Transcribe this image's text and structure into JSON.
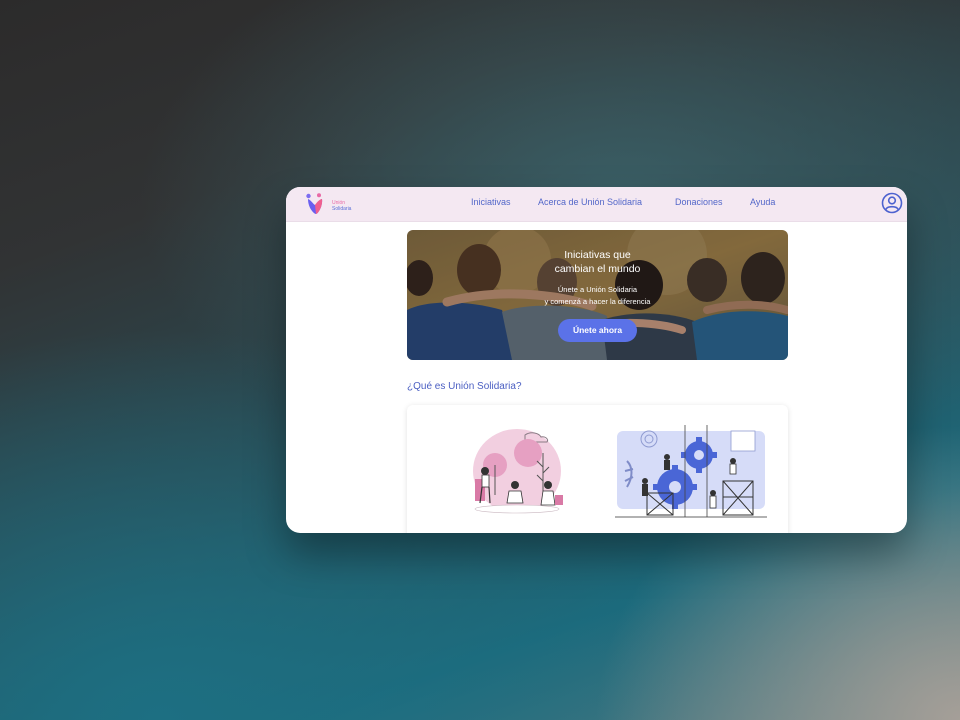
{
  "brand": {
    "line1": "Unión",
    "line2": "Solidaria"
  },
  "nav": {
    "items": [
      {
        "label": "Iniciativas"
      },
      {
        "label": "Acerca de Unión Solidaria"
      },
      {
        "label": "Donaciones"
      },
      {
        "label": "Ayuda"
      }
    ]
  },
  "hero": {
    "title_line1": "Iniciativas que",
    "title_line2": "cambian el mundo",
    "subtitle_line1": "Únete a Unión Solidaria",
    "subtitle_line2": "y comenzá a hacer la diferencia",
    "cta_label": "Únete ahora"
  },
  "about": {
    "title": "¿Qué es Unión Solidaria?"
  },
  "colors": {
    "accent": "#5b72e8",
    "nav_text": "#5367c9",
    "nav_bg": "#f4e8f2",
    "pink": "#e6a9c8",
    "illustration_blue": "#4a66d6"
  },
  "icons": [
    "user-circle-icon",
    "brand-logo-icon"
  ]
}
